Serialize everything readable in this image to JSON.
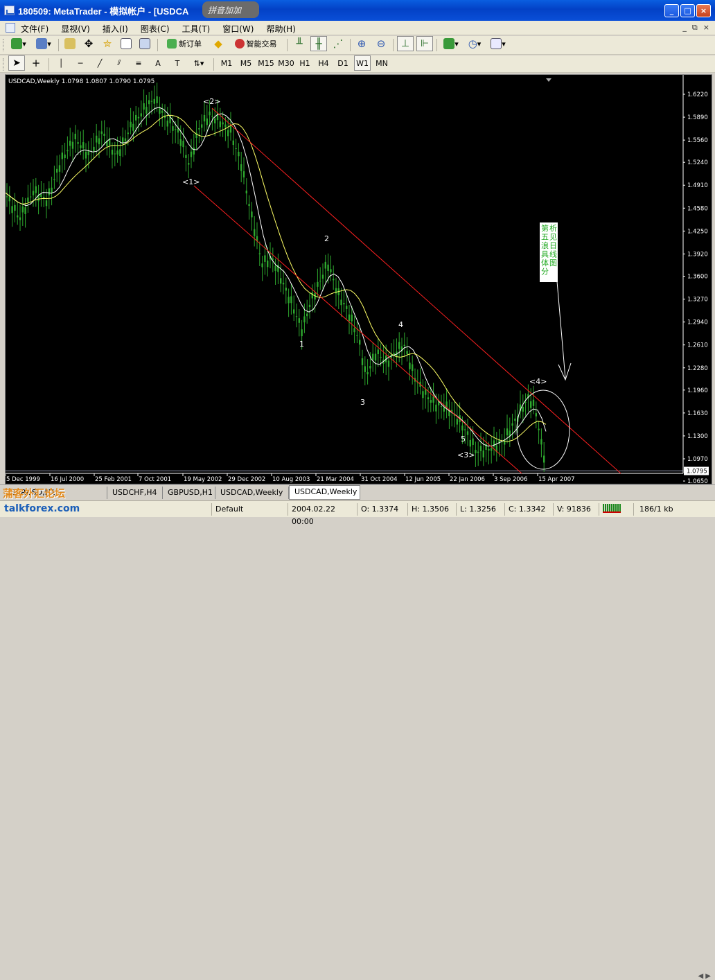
{
  "window": {
    "title": "180509: MetaTrader - 模拟帐户 - [USDCA",
    "stamp": "拼音加加",
    "buttons": [
      "_",
      "□",
      "×"
    ]
  },
  "menu": {
    "items": [
      "文件(F)",
      "显视(V)",
      "插入(I)",
      "图表(C)",
      "工具(T)",
      "窗口(W)",
      "帮助(H)"
    ],
    "mdi_buttons": [
      "_",
      "⧉",
      "×"
    ]
  },
  "toolbar": {
    "new_order": "新订单",
    "expert": "智能交易",
    "timeframes": [
      "M1",
      "M5",
      "M15",
      "M30",
      "H1",
      "H4",
      "D1",
      "W1",
      "MN"
    ],
    "active_timeframe": "W1"
  },
  "chart": {
    "header": "USDCAD,Weekly  1.0798 1.0807 1.0790 1.0795",
    "current_price": "1.0795",
    "price_labels": [
      "1.6220",
      "1.5890",
      "1.5560",
      "1.5240",
      "1.4910",
      "1.4580",
      "1.4250",
      "1.3920",
      "1.3600",
      "1.3270",
      "1.2940",
      "1.2610",
      "1.2280",
      "1.1960",
      "1.1630",
      "1.1300",
      "1.0970",
      "1.0650"
    ],
    "date_labels": [
      "5 Dec 1999",
      "16 Jul 2000",
      "25 Feb 2001",
      "7 Oct 2001",
      "19 May 2002",
      "29 Dec 2002",
      "10 Aug 2003",
      "21 Mar 2004",
      "31 Oct 2004",
      "12 Jun 2005",
      "22 Jan 2006",
      "3 Sep 2006",
      "15 Apr 2007"
    ],
    "wave_labels": [
      "<1>",
      "<2>",
      "<3>",
      "<4>",
      "1",
      "2",
      "3",
      "4",
      "5"
    ],
    "note_text": "第五浪具体分析见日线图",
    "colors": {
      "candles": "#2ea82e",
      "ma_fast": "#ffffff",
      "ma_slow": "#ffff66",
      "channel": "#ff2020",
      "annotation": "#ffffff",
      "note_text": "#22aa22"
    }
  },
  "tabs": [
    "EURUSD,H1",
    "USDCHF,H4",
    "GBPUSD,H1",
    "USDCAD,Weekly",
    "USDCAD,Weekly"
  ],
  "active_tab_index": 4,
  "watermark": "蒲客外汇论坛",
  "status": {
    "site": "talkforex.com",
    "profile": "Default",
    "datetime": "2004.02.22 00:00",
    "open": "O: 1.3374",
    "high": "H: 1.3506",
    "low": "L: 1.3256",
    "close": "C: 1.3342",
    "volume": "V: 91836",
    "traffic": "186/1 kb"
  }
}
